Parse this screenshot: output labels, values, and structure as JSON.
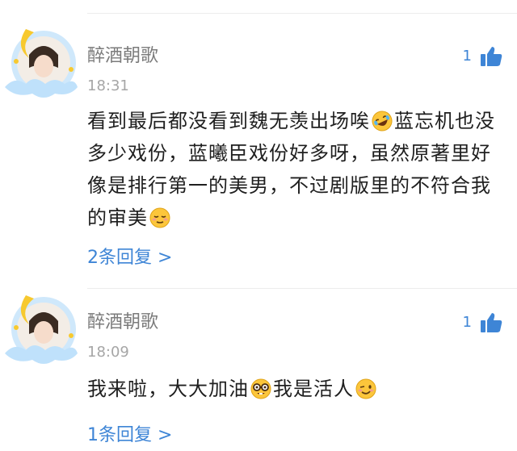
{
  "comments": [
    {
      "username": "醉酒朝歌",
      "time": "18:31",
      "likes": "1",
      "text_segments": [
        "看到最后都没看到魏无羡出场唉",
        "蓝忘机也没多少戏份，蓝曦臣戏份好多呀，虽然原著里好像是排行第一的美男，不过剧版里的不符合我的审美"
      ],
      "emojis": [
        "rolling-laugh-emoji",
        "relieved-face-emoji"
      ],
      "replies": "2条回复 >"
    },
    {
      "username": "醉酒朝歌",
      "time": "18:09",
      "likes": "1",
      "text_segments": [
        "我来啦，大大加油",
        "我是活人"
      ],
      "emojis": [
        "nerd-face-emoji",
        "wink-face-emoji"
      ],
      "replies": "1条回复 >"
    }
  ],
  "colors": {
    "accent": "#3e85d6",
    "username": "#7b7b7b",
    "time": "#a6a6a6",
    "body": "#1f1f1f"
  }
}
